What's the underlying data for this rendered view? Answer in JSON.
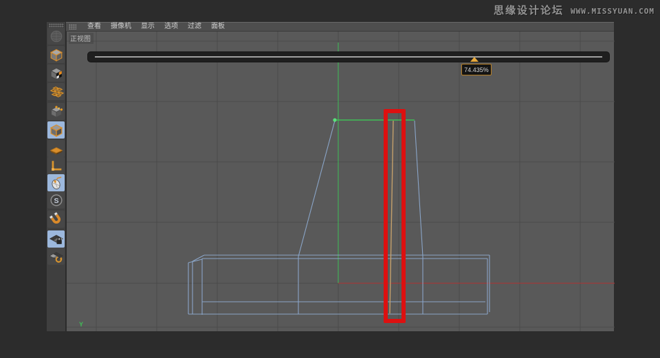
{
  "watermark": {
    "site_name": "思缘设计论坛",
    "site_url": "WWW.MISSYUAN.COM"
  },
  "menu_bar": {
    "items": [
      {
        "label": "查看"
      },
      {
        "label": "摄像机"
      },
      {
        "label": "显示"
      },
      {
        "label": "选项"
      },
      {
        "label": "过滤"
      },
      {
        "label": "面板"
      }
    ]
  },
  "viewport": {
    "view_label": "正视图",
    "axis_label_y": "Y"
  },
  "slider": {
    "value_label": "74.435%",
    "percent": 74.435
  },
  "toolbar": {
    "tools": [
      {
        "name": "convert-to-editable",
        "state": "disabled"
      },
      {
        "name": "model-mode",
        "state": "normal"
      },
      {
        "name": "texture-mode",
        "state": "normal"
      },
      {
        "name": "uv-texture-mode",
        "state": "normal"
      },
      {
        "name": "points-mode",
        "state": "normal"
      },
      {
        "name": "edges-mode",
        "state": "selected"
      },
      {
        "name": "polygons-mode",
        "state": "normal"
      },
      {
        "name": "enable-axis",
        "state": "normal"
      },
      {
        "name": "tweak-mode",
        "state": "selected"
      },
      {
        "name": "snap-settings",
        "state": "normal"
      },
      {
        "name": "magnet-snap",
        "state": "normal"
      },
      {
        "name": "lock-workplane",
        "state": "selected"
      },
      {
        "name": "workplane",
        "state": "normal"
      }
    ]
  },
  "colors": {
    "accent_orange": "#d98e2b",
    "selection_blue": "#9cb8dd",
    "axis_green": "#3fbf57",
    "axis_red": "#a03a3a",
    "wireframe_blue": "#8aa5c8",
    "highlight_edge_tan": "#c4a06b",
    "annotation_red": "#dd1010",
    "viewport_background": "#595959"
  },
  "annotation": {
    "type": "highlight-rectangle"
  }
}
